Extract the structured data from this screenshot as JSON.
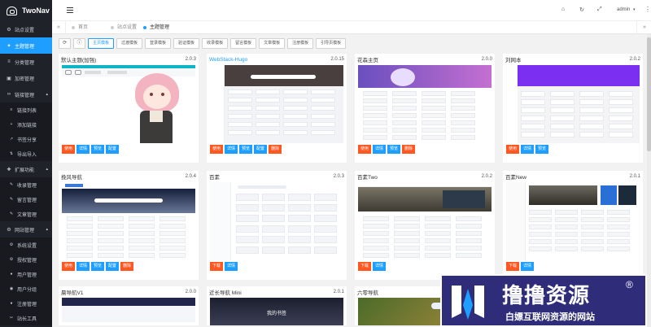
{
  "app": {
    "title": "TwoNav"
  },
  "sidebar": {
    "items": [
      {
        "label": "站点设置",
        "icon": "gear-icon"
      },
      {
        "label": "主题管理",
        "icon": "shirt-icon",
        "active": true
      },
      {
        "label": "分类管理",
        "icon": "list-icon"
      },
      {
        "label": "加密管理",
        "icon": "lock-icon"
      },
      {
        "label": "链接管理",
        "icon": "link-icon",
        "group": true
      },
      {
        "label": "链接列表",
        "icon": "list-icon",
        "sub": true
      },
      {
        "label": "添加链接",
        "icon": "plus-icon",
        "sub": true
      },
      {
        "label": "书签分享",
        "icon": "share-icon",
        "sub": true
      },
      {
        "label": "导出导入",
        "icon": "swap-icon",
        "sub": true
      },
      {
        "label": "扩展功能",
        "icon": "puzzle-icon",
        "group": true
      },
      {
        "label": "收录管理",
        "icon": "edit-icon",
        "sub": true
      },
      {
        "label": "留言管理",
        "icon": "edit-icon",
        "sub": true
      },
      {
        "label": "文章管理",
        "icon": "edit-icon",
        "sub": true
      },
      {
        "label": "网站管理",
        "icon": "gear-icon",
        "group": true
      },
      {
        "label": "系统设置",
        "icon": "gear-icon",
        "sub": true
      },
      {
        "label": "授权管理",
        "icon": "gear-icon",
        "sub": true
      },
      {
        "label": "用户管理",
        "icon": "user-icon",
        "sub": true
      },
      {
        "label": "用户分组",
        "icon": "users-icon",
        "sub": true
      },
      {
        "label": "注册管理",
        "icon": "user-icon",
        "sub": true
      },
      {
        "label": "站长工具",
        "icon": "wrench-icon",
        "sub": true
      }
    ]
  },
  "header": {
    "user": "admin",
    "caret": "▾"
  },
  "tabs": [
    {
      "label": "首页"
    },
    {
      "label": "站点设置"
    },
    {
      "label": "主题管理",
      "current": true
    }
  ],
  "toolbar": {
    "buttons": [
      "主页模板",
      "过渡模板",
      "登录模板",
      "验证模板",
      "收录模板",
      "留言模板",
      "文章模板",
      "注册模板",
      "引导页模板"
    ]
  },
  "cards": [
    {
      "name": "默认主题(加强)",
      "version": "2.0.3",
      "actions": [
        "使用",
        "详情",
        "预览",
        "配置"
      ],
      "style": "default"
    },
    {
      "name": "WebStack-Hugo",
      "version": "2.0.15",
      "actions": [
        "使用",
        "详情",
        "预览",
        "配置",
        "删除"
      ],
      "style": "webstack",
      "link": true
    },
    {
      "name": "花森主页",
      "version": "2.0.0",
      "actions": [
        "使用",
        "详情",
        "预览",
        "删除"
      ],
      "style": "huasen"
    },
    {
      "name": "刘网本",
      "version": "2.0.2",
      "actions": [
        "使用",
        "详情",
        "预览"
      ],
      "style": "purple"
    },
    {
      "name": "挽风导航",
      "version": "2.0.4",
      "actions": [
        "使用",
        "详情",
        "预览",
        "配置",
        "删除"
      ],
      "style": "wanfeng"
    },
    {
      "name": "百素",
      "version": "2.0.3",
      "actions": [
        "下载",
        "详情"
      ],
      "style": "baisu"
    },
    {
      "name": "百素Two",
      "version": "2.0.2",
      "actions": [
        "下载",
        "详情"
      ],
      "style": "baisutwo"
    },
    {
      "name": "百素New",
      "version": "2.0.1",
      "actions": [
        "下载",
        "详情"
      ],
      "style": "baisunew"
    },
    {
      "name": "晨导航V1",
      "version": "2.0.0",
      "actions": [],
      "style": "chen"
    },
    {
      "name": "近长导航 Mini",
      "version": "2.0.1",
      "actions": [],
      "style": "mini"
    },
    {
      "name": "六零导航",
      "version": "",
      "actions": [],
      "style": "liuling"
    }
  ],
  "card_mock_text": {
    "webstack_search": "",
    "wanfeng_hero": "",
    "baisu_mine": "我的书签",
    "mini_hero": "我的书签"
  },
  "watermark": {
    "title": "撸撸资源",
    "reg": "®",
    "subtitle": "白嫖互联网资源的网站"
  },
  "colors": {
    "accent": "#1e9fff",
    "danger": "#ff5722",
    "sidebar": "#20222a"
  }
}
